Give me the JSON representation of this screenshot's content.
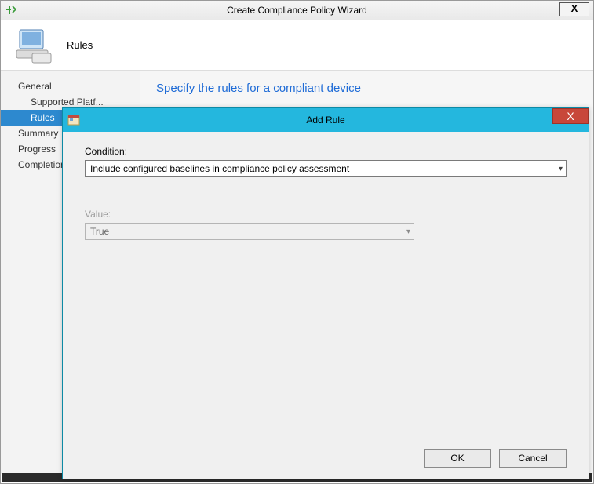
{
  "wizard": {
    "title": "Create Compliance Policy Wizard",
    "close_glyph": "X",
    "header_label": "Rules",
    "main_heading": "Specify the rules for a compliant device"
  },
  "sidebar": {
    "items": [
      {
        "label": "General"
      },
      {
        "label": "Supported Platf..."
      },
      {
        "label": "Rules"
      },
      {
        "label": "Summary"
      },
      {
        "label": "Progress"
      },
      {
        "label": "Completion"
      }
    ],
    "selected_index": 2
  },
  "modal": {
    "title": "Add Rule",
    "close_glyph": "X",
    "condition_label": "Condition:",
    "condition_value": "Include configured baselines in compliance policy assessment",
    "value_label": "Value:",
    "value_value": "True",
    "ok_label": "OK",
    "cancel_label": "Cancel"
  }
}
